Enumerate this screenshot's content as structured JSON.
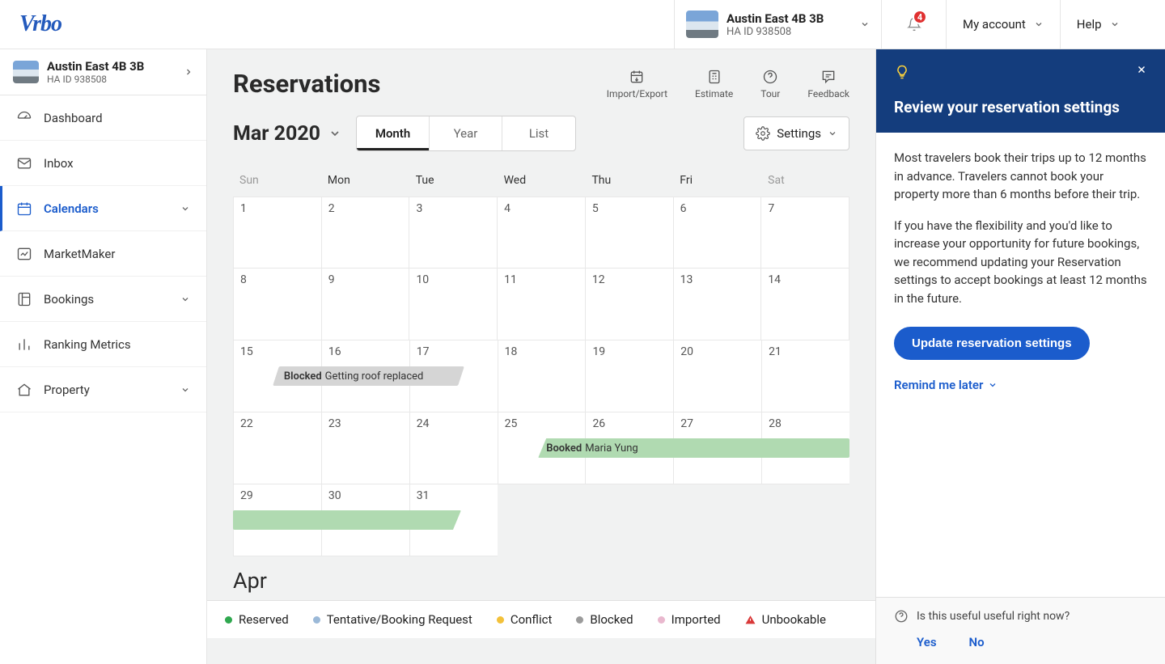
{
  "brand": "Vrbo",
  "header": {
    "property_name": "Austin East 4B 3B",
    "property_sub": "HA ID 938508",
    "badge_count": "4",
    "account": "My account",
    "help": "Help"
  },
  "sidebar": {
    "property_name": "Austin East 4B 3B",
    "property_sub": "HA ID 938508",
    "items": [
      {
        "label": "Dashboard",
        "icon": "dashboard"
      },
      {
        "label": "Inbox",
        "icon": "inbox"
      },
      {
        "label": "Calendars",
        "icon": "calendar",
        "active": true,
        "expandable": true
      },
      {
        "label": "MarketMaker",
        "icon": "market"
      },
      {
        "label": "Bookings",
        "icon": "bookings",
        "expandable": true
      },
      {
        "label": "Ranking Metrics",
        "icon": "ranking"
      },
      {
        "label": "Property",
        "icon": "property",
        "expandable": true
      }
    ]
  },
  "main": {
    "title": "Reservations",
    "actions": {
      "import_export": "Import/Export",
      "estimate": "Estimate",
      "tour": "Tour",
      "feedback": "Feedback"
    },
    "month_label": "Mar 2020",
    "tabs": {
      "month": "Month",
      "year": "Year",
      "list": "List"
    },
    "settings": "Settings",
    "day_headers": [
      "Sun",
      "Mon",
      "Tue",
      "Wed",
      "Thu",
      "Fri",
      "Sat"
    ],
    "weeks": [
      [
        "1",
        "2",
        "3",
        "4",
        "5",
        "6",
        "7"
      ],
      [
        "8",
        "9",
        "10",
        "11",
        "12",
        "13",
        "14"
      ],
      [
        "15",
        "16",
        "17",
        "18",
        "19",
        "20",
        "21"
      ],
      [
        "22",
        "23",
        "24",
        "25",
        "26",
        "27",
        "28"
      ],
      [
        "29",
        "30",
        "31",
        "",
        "",
        "",
        ""
      ]
    ],
    "events": {
      "blocked": {
        "label": "Blocked",
        "text": "Getting roof replaced"
      },
      "booked": {
        "label": "Booked",
        "text": "Maria Yung"
      }
    },
    "next_month": "Apr",
    "legend": {
      "reserved": "Reserved",
      "tentative": "Tentative/Booking Request",
      "conflict": "Conflict",
      "blocked": "Blocked",
      "imported": "Imported",
      "unbookable": "Unbookable"
    }
  },
  "panel": {
    "title": "Review your reservation settings",
    "p1": "Most travelers book their trips up to 12 months in advance. Travelers cannot book your property more than 6 months before their trip.",
    "p2": "If you have the flexibility and you'd like to increase your opportunity for future bookings, we recommend updating your Reservation settings to accept bookings at least 12 months in the future.",
    "cta": "Update reservation settings",
    "remind": "Remind me later",
    "footer_q": "Is this useful useful right now?",
    "yes": "Yes",
    "no": "No"
  },
  "colors": {
    "reserved": "#2fa84f",
    "tentative": "#9bb9d8",
    "conflict": "#f3c13a",
    "blocked": "#9b9b9b",
    "imported": "#e9b8ce",
    "unbookable": "#d93838"
  }
}
